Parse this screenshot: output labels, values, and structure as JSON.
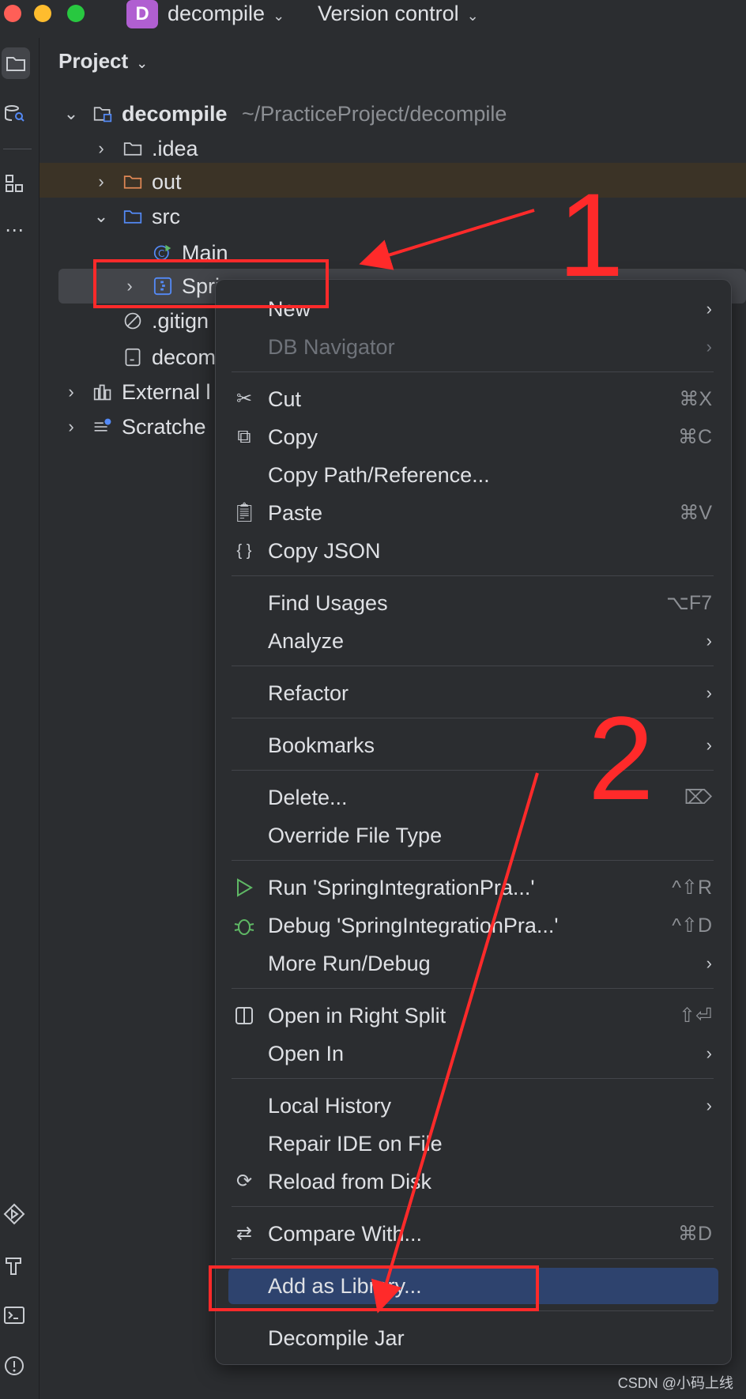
{
  "window": {
    "project_badge": "D",
    "project_name": "decompile",
    "version_control": "Version control"
  },
  "panel": {
    "title": "Project"
  },
  "tree": {
    "root_name": "decompile",
    "root_path": "~/PracticeProject/decompile",
    "idea": ".idea",
    "out": "out",
    "src": "src",
    "main": "Main",
    "spring_partial": "Spri",
    "gitignore_partial": ".gitign",
    "decom_partial": "decom",
    "external_partial": "External l",
    "scratches_partial": "Scratche"
  },
  "menu": {
    "items": [
      {
        "label": "New",
        "shortcut": "",
        "icon": "",
        "submenu": true,
        "disabled": false
      },
      {
        "label": "DB Navigator",
        "shortcut": "",
        "icon": "",
        "submenu": true,
        "disabled": true
      },
      {
        "label": "Cut",
        "shortcut": "⌘X",
        "icon": "scissors-icon",
        "submenu": false,
        "disabled": false
      },
      {
        "label": "Copy",
        "shortcut": "⌘C",
        "icon": "copy-icon",
        "submenu": false,
        "disabled": false
      },
      {
        "label": "Copy Path/Reference...",
        "shortcut": "",
        "icon": "",
        "submenu": false,
        "disabled": false
      },
      {
        "label": "Paste",
        "shortcut": "⌘V",
        "icon": "paste-icon",
        "submenu": false,
        "disabled": false
      },
      {
        "label": "Copy JSON",
        "shortcut": "",
        "icon": "braces-icon",
        "submenu": false,
        "disabled": false
      },
      {
        "label": "Find Usages",
        "shortcut": "⌥F7",
        "icon": "",
        "submenu": false,
        "disabled": false
      },
      {
        "label": "Analyze",
        "shortcut": "",
        "icon": "",
        "submenu": true,
        "disabled": false
      },
      {
        "label": "Refactor",
        "shortcut": "",
        "icon": "",
        "submenu": true,
        "disabled": false
      },
      {
        "label": "Bookmarks",
        "shortcut": "",
        "icon": "",
        "submenu": true,
        "disabled": false
      },
      {
        "label": "Delete...",
        "shortcut": "⌦",
        "icon": "",
        "submenu": false,
        "disabled": false
      },
      {
        "label": "Override File Type",
        "shortcut": "",
        "icon": "",
        "submenu": false,
        "disabled": false
      },
      {
        "label": "Run 'SpringIntegrationPra...'",
        "shortcut": "^⇧R",
        "icon": "run-icon",
        "submenu": false,
        "disabled": false
      },
      {
        "label": "Debug 'SpringIntegrationPra...'",
        "shortcut": "^⇧D",
        "icon": "debug-icon",
        "submenu": false,
        "disabled": false
      },
      {
        "label": "More Run/Debug",
        "shortcut": "",
        "icon": "",
        "submenu": true,
        "disabled": false
      },
      {
        "label": "Open in Right Split",
        "shortcut": "⇧⏎",
        "icon": "split-icon",
        "submenu": false,
        "disabled": false
      },
      {
        "label": "Open In",
        "shortcut": "",
        "icon": "",
        "submenu": true,
        "disabled": false
      },
      {
        "label": "Local History",
        "shortcut": "",
        "icon": "",
        "submenu": true,
        "disabled": false
      },
      {
        "label": "Repair IDE on File",
        "shortcut": "",
        "icon": "",
        "submenu": false,
        "disabled": false
      },
      {
        "label": "Reload from Disk",
        "shortcut": "",
        "icon": "reload-icon",
        "submenu": false,
        "disabled": false
      },
      {
        "label": "Compare With...",
        "shortcut": "⌘D",
        "icon": "compare-icon",
        "submenu": false,
        "disabled": false
      },
      {
        "label": "Add as Library...",
        "shortcut": "",
        "icon": "",
        "submenu": false,
        "disabled": false
      },
      {
        "label": "Decompile Jar",
        "shortcut": "",
        "icon": "",
        "submenu": false,
        "disabled": false
      }
    ]
  },
  "annotations": {
    "step1": "1",
    "step2": "2",
    "color": "#ff2a2a"
  },
  "watermark": "CSDN @小码上线"
}
